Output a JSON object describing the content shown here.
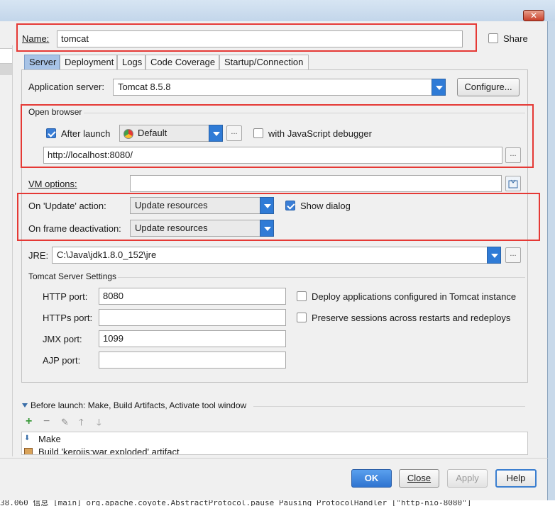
{
  "name_label": "Name:",
  "name_value": "tomcat",
  "share_label": "Share",
  "tabs": [
    "Server",
    "Deployment",
    "Logs",
    "Code Coverage",
    "Startup/Connection"
  ],
  "app_server": {
    "label": "Application server:",
    "value": "Tomcat 8.5.8",
    "configure": "Configure..."
  },
  "open_browser": {
    "title": "Open browser",
    "after_launch": "After launch",
    "browser": "Default",
    "dots": "...",
    "js_debugger": "with JavaScript debugger",
    "url": "http://localhost:8080/"
  },
  "vm_options": {
    "label": "VM options:",
    "value": ""
  },
  "update": {
    "on_update_label": "On 'Update' action:",
    "on_update_value": "Update resources",
    "show_dialog": "Show dialog",
    "on_frame_label": "On frame deactivation:",
    "on_frame_value": "Update resources"
  },
  "jre": {
    "label": "JRE:",
    "value": "C:\\Java\\jdk1.8.0_152\\jre",
    "dots": "..."
  },
  "tomcat_settings": {
    "title": "Tomcat Server Settings",
    "http_label": "HTTP port:",
    "http_value": "8080",
    "https_label": "HTTPs port:",
    "https_value": "",
    "jmx_label": "JMX port:",
    "jmx_value": "1099",
    "ajp_label": "AJP port:",
    "ajp_value": "",
    "deploy_label": "Deploy applications configured in Tomcat instance",
    "preserve_label": "Preserve sessions across restarts and redeploys"
  },
  "before_launch": {
    "title": "Before launch: Make, Build Artifacts, Activate tool window",
    "items": [
      "Make",
      "Build 'kerojis:war exploded' artifact"
    ]
  },
  "buttons": {
    "ok": "OK",
    "close": "Close",
    "apply": "Apply",
    "help": "Help"
  },
  "status_text": "38.060 信息 [main] org.apache.coyote.AbstractProtocol.pause Pausing ProtocolHandler [\"http-nio-8080\"]",
  "colors": {
    "accent": "#2f7bd6",
    "highlight_border": "#e53935"
  },
  "icons": {
    "close": "close-icon",
    "chrome": "chrome-icon",
    "vm_expand": "expand-icon",
    "add": "add-icon",
    "remove": "remove-icon",
    "edit": "edit-icon",
    "up": "arrow-up-icon",
    "down": "arrow-down-icon"
  }
}
